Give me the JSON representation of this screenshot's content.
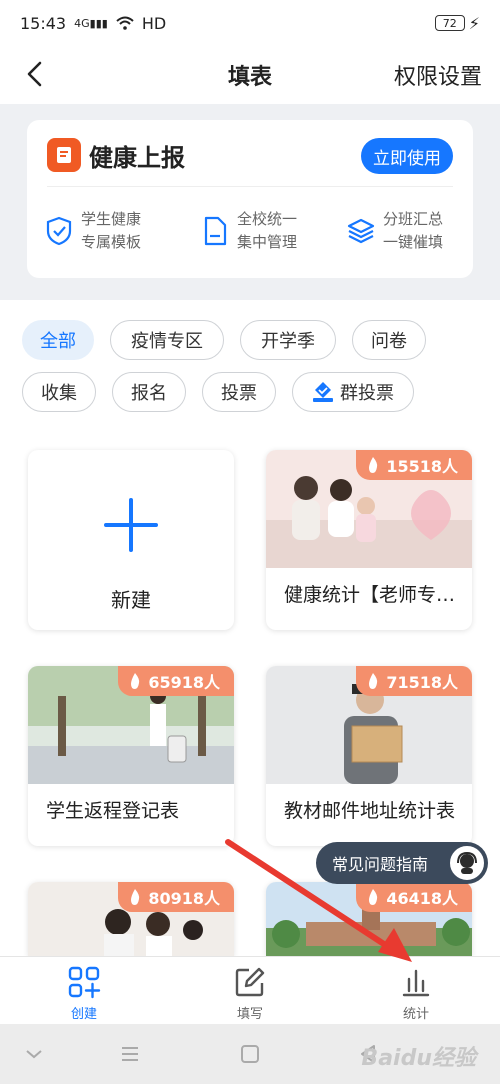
{
  "status_bar": {
    "time": "15:43",
    "network": "4G",
    "hd": "HD",
    "battery": "72"
  },
  "navbar": {
    "title": "填表",
    "right_label": "权限设置"
  },
  "health_card": {
    "title": "健康上报",
    "button": "立即使用",
    "features": [
      {
        "line1": "学生健康",
        "line2": "专属模板",
        "icon": "shield-check-icon"
      },
      {
        "line1": "全校统一",
        "line2": "集中管理",
        "icon": "document-icon"
      },
      {
        "line1": "分班汇总",
        "line2": "一键催填",
        "icon": "layers-icon"
      }
    ]
  },
  "filters": [
    "全部",
    "疫情专区",
    "开学季",
    "问卷",
    "收集",
    "报名",
    "投票",
    "群投票"
  ],
  "tiles": {
    "new_label": "新建",
    "items": [
      {
        "name": "健康统计【老师专用】",
        "count": "15518人"
      },
      {
        "name": "学生返程登记表",
        "count": "65918人"
      },
      {
        "name": "教材邮件地址统计表",
        "count": "71518人"
      },
      {
        "name": "",
        "count": "80918人"
      },
      {
        "name": "",
        "count": "46418人"
      }
    ]
  },
  "faq": {
    "label": "常见问题指南"
  },
  "tabbar": [
    {
      "label": "创建",
      "icon": "grid-plus-icon"
    },
    {
      "label": "填写",
      "icon": "edit-icon"
    },
    {
      "label": "统计",
      "icon": "bar-chart-icon"
    }
  ],
  "watermark": "Baidu经验",
  "colors": {
    "accent": "#1677ff",
    "badge": "#f48f6c",
    "health_icon": "#f05a24"
  }
}
